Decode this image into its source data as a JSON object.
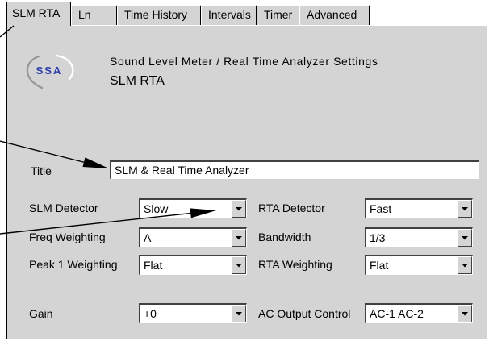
{
  "window": {
    "active_tab": 0
  },
  "tabs": [
    {
      "label": "SLM RTA"
    },
    {
      "label": "Ln"
    },
    {
      "label": "Time History"
    },
    {
      "label": "Intervals"
    },
    {
      "label": "Timer"
    },
    {
      "label": "Advanced"
    }
  ],
  "header": {
    "logo_text": "SSA",
    "title": "Sound Level Meter / Real Time Analyzer Settings",
    "subtitle": "SLM RTA"
  },
  "form": {
    "title_field": {
      "label": "Title",
      "value": "SLM & Real Time Analyzer"
    },
    "rows": [
      {
        "left": {
          "label": "SLM Detector",
          "value": "Slow"
        },
        "right": {
          "label": "RTA Detector",
          "value": "Fast"
        }
      },
      {
        "left": {
          "label": "Freq Weighting",
          "value": "A"
        },
        "right": {
          "label": "Bandwidth",
          "value": "1/3"
        }
      },
      {
        "left": {
          "label": "Peak 1 Weighting",
          "value": "Flat"
        },
        "right": {
          "label": "RTA Weighting",
          "value": "Flat"
        }
      },
      {
        "left": {
          "label": "Gain",
          "value": "+0"
        },
        "right": {
          "label": "AC Output Control",
          "value": "AC-1 AC-2"
        }
      }
    ]
  },
  "icons": {
    "dropdown": "chevron-down-icon",
    "logo": "ssa-logo",
    "callout": "arrow-icon"
  },
  "colors": {
    "page": "#ffffff",
    "panel": "#d4d4d4",
    "field": "#ffffff",
    "ink": "#000000",
    "logo_text": "#2a3caa",
    "logo_swoosh": "#9a9a9a"
  }
}
